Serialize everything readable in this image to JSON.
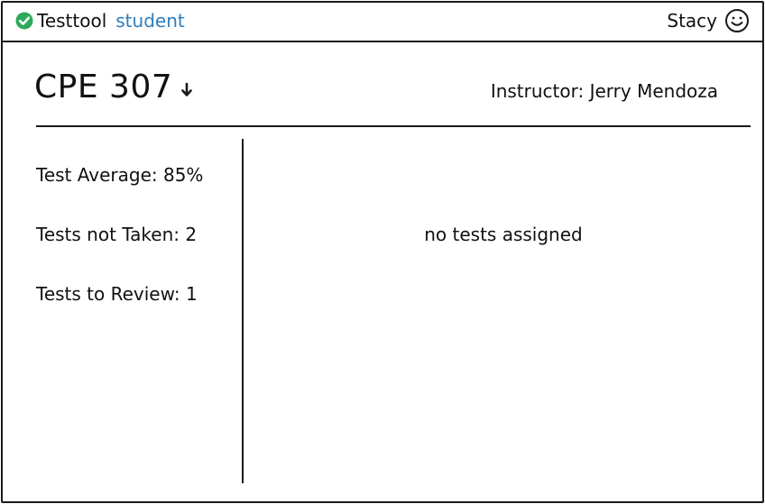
{
  "header": {
    "app_name": "Testtool",
    "role": "student",
    "role_color": "#2e7dbd",
    "check_color": "#2eaa5a",
    "user_name": "Stacy",
    "brand_icon": "check-circle-icon",
    "user_icon": "smiley-icon"
  },
  "course": {
    "title": "CPE 307",
    "dropdown_icon": "arrow-down-icon",
    "instructor": "Instructor: Jerry Mendoza"
  },
  "sidebar": {
    "stats": [
      {
        "label": "Test Average: 85%"
      },
      {
        "label": "Tests not Taken: 2"
      },
      {
        "label": "Tests to Review: 1"
      }
    ]
  },
  "main": {
    "empty_message": "no tests assigned"
  }
}
